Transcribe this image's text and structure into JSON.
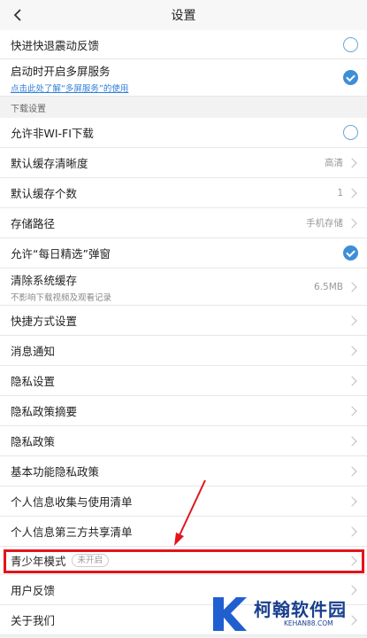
{
  "header": {
    "title": "设置"
  },
  "rows": {
    "quick_back": "快进快退震动反馈",
    "multiscreen": "启动时开启多屏服务",
    "multiscreen_link": "点击此处了解“多屏服务”的使用",
    "download_section": "下载设置",
    "non_wifi": "允许非WI-FI下载",
    "cache_quality": "默认缓存清晰度",
    "cache_quality_val": "高清",
    "cache_count": "默认缓存个数",
    "cache_count_val": "1",
    "storage": "存储路径",
    "storage_val": "手机存储",
    "daily_popup": "允许“每日精选”弹窗",
    "clear_cache": "清除系统缓存",
    "clear_cache_sub": "不影响下载视频及观看记录",
    "clear_cache_val": "6.5MB",
    "shortcut": "快捷方式设置",
    "notify": "消息通知",
    "privacy_settings": "隐私设置",
    "privacy_summary": "隐私政策摘要",
    "privacy_policy": "隐私政策",
    "basic_privacy": "基本功能隐私政策",
    "info_collect": "个人信息收集与使用清单",
    "third_party": "个人信息第三方共享清单",
    "youth_mode": "青少年模式",
    "youth_mode_badge": "未开启",
    "feedback": "用户反馈",
    "about": "关于我们"
  },
  "toggles": {
    "quick_back": false,
    "multiscreen": true,
    "non_wifi": false,
    "daily_popup": true
  },
  "watermark": {
    "cn": "柯翰软件园",
    "en": "KEHAN88.COM"
  },
  "colors": {
    "accent": "#3e8ed6",
    "highlight": "#e2141c",
    "link": "#2f7fd9"
  }
}
